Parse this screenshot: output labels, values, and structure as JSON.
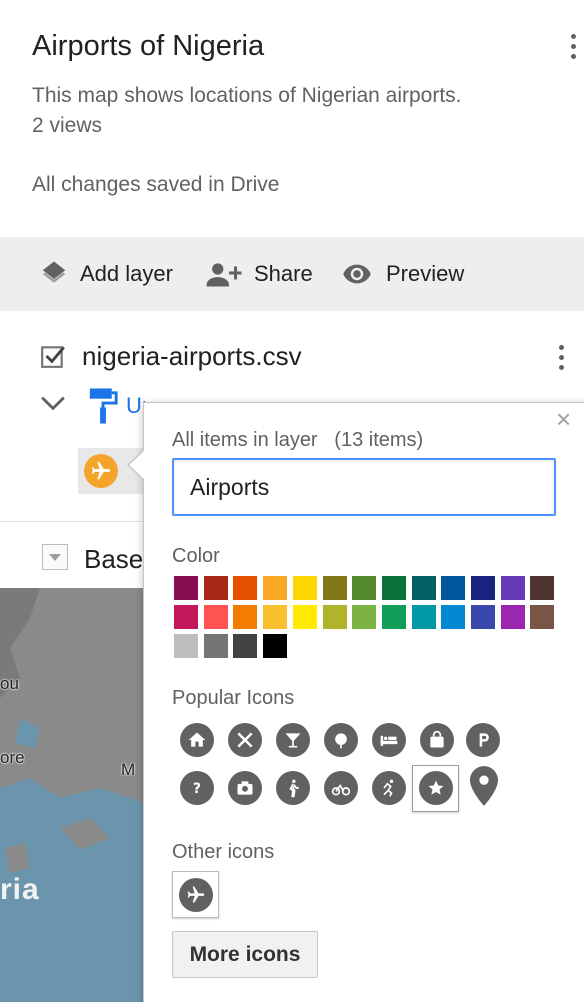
{
  "header": {
    "title": "Airports of Nigeria",
    "description": "This map shows locations of Nigerian airports.",
    "views": "2 views",
    "save_status": "All changes saved in Drive"
  },
  "toolbar": {
    "add_layer": "Add layer",
    "share": "Share",
    "preview": "Preview"
  },
  "layer": {
    "name": "nigeria-airports.csv",
    "checked": true,
    "style_link": "Uniform style",
    "item_icon": "airport-icon",
    "item_color": "#f4a42a"
  },
  "base_map": {
    "label": "Base map"
  },
  "map": {
    "labels": [
      "ou",
      "ore",
      "M",
      "ria"
    ]
  },
  "popup": {
    "items_label": "All items in layer",
    "items_count": "(13 items)",
    "name_value": "Airports",
    "color_label": "Color",
    "colors": [
      [
        "#880e4f",
        "#a52714",
        "#e65100",
        "#f9a825",
        "#ffd600",
        "#817717",
        "#558b2f",
        "#097138",
        "#006064",
        "#01579b",
        "#1a237e",
        "#673ab7",
        "#4e342e"
      ],
      [
        "#c2185b",
        "#ff5252",
        "#f57c00",
        "#fbc02d",
        "#ffea00",
        "#afb42b",
        "#7cb342",
        "#0f9d58",
        "#0097a7",
        "#0288d1",
        "#3949ab",
        "#9c27b0",
        "#795548"
      ],
      [
        "#bdbdbd",
        "#757575",
        "#424242",
        "#000000"
      ]
    ],
    "popular_icons_label": "Popular Icons",
    "popular_icons": [
      [
        "home-icon",
        "restaurant-icon",
        "bar-icon",
        "park-icon",
        "hotel-icon",
        "shopping-icon",
        "parking-icon"
      ],
      [
        "help-icon",
        "camera-icon",
        "hiking-icon",
        "cycling-icon",
        "running-icon",
        "star-icon",
        "place-pin-icon"
      ]
    ],
    "selected_icon": "star-icon",
    "other_icons_label": "Other icons",
    "other_icons": [
      "airport-icon"
    ],
    "more_icons_button": "More icons",
    "close": "×"
  }
}
